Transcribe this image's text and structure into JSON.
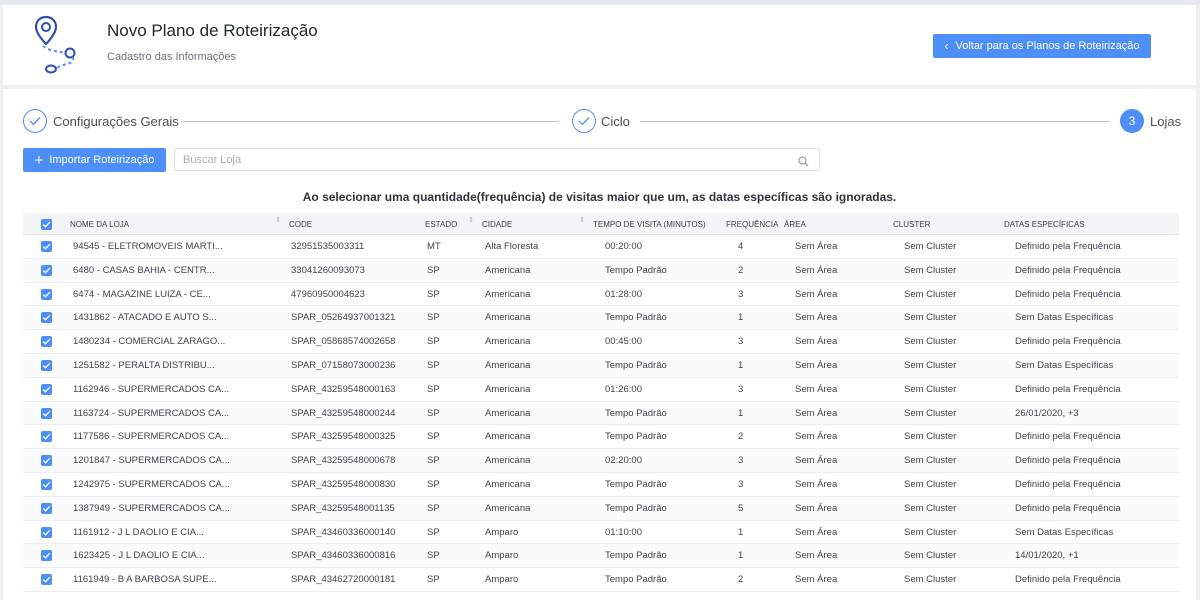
{
  "header": {
    "title": "Novo Plano de Roteirização",
    "subtitle": "Cadastro das Informações",
    "back_button": "Voltar para os Planos de Roteirização"
  },
  "steps": [
    {
      "label": "Configurações Gerais",
      "state": "done"
    },
    {
      "label": "Ciclo",
      "state": "done"
    },
    {
      "label": "Lojas",
      "number": "3",
      "state": "active"
    }
  ],
  "toolbar": {
    "import_label": "Importar Roteirização",
    "search_placeholder": "Buscar Loja"
  },
  "notice": "Ao selecionar uma quantidade(frequência) de visitas maior que um, as datas específicas são ignoradas.",
  "table": {
    "columns": {
      "nome": "NOME DA LOJA",
      "code": "CODE",
      "estado": "ESTADO",
      "cidade": "CIDADE",
      "tempo": "TEMPO DE VISITA (MINUTOS)",
      "frequencia": "FREQUÊNCIA",
      "area": "ÁREA",
      "cluster": "CLUSTER",
      "datas": "DATAS ESPECÍFICAS"
    },
    "rows": [
      {
        "nome": "94545 - ELETROMOVEIS MARTI...",
        "code": "32951535003311",
        "estado": "MT",
        "cidade": "Alta Floresta",
        "tempo": "00:20:00",
        "frequencia": "4",
        "area": "Sem Área",
        "cluster": "Sem Cluster",
        "datas": "Definido pela Frequência"
      },
      {
        "nome": "6480 - CASAS BAHIA - CENTR...",
        "code": "33041260093073",
        "estado": "SP",
        "cidade": "Americana",
        "tempo": "Tempo Padrão",
        "frequencia": "2",
        "area": "Sem Área",
        "cluster": "Sem Cluster",
        "datas": "Definido pela Frequência"
      },
      {
        "nome": "6474 - MAGAZINE LUIZA - CE...",
        "code": "47960950004623",
        "estado": "SP",
        "cidade": "Americana",
        "tempo": "01:28:00",
        "frequencia": "3",
        "area": "Sem Área",
        "cluster": "Sem Cluster",
        "datas": "Definido pela Frequência"
      },
      {
        "nome": "1431862 - ATACADO E AUTO S...",
        "code": "SPAR_05264937001321",
        "estado": "SP",
        "cidade": "Americana",
        "tempo": "Tempo Padrão",
        "frequencia": "1",
        "area": "Sem Área",
        "cluster": "Sem Cluster",
        "datas": "Sem Datas Específicas"
      },
      {
        "nome": "1480234 - COMERCIAL ZARAGO...",
        "code": "SPAR_05868574002658",
        "estado": "SP",
        "cidade": "Americana",
        "tempo": "00:45:00",
        "frequencia": "3",
        "area": "Sem Área",
        "cluster": "Sem Cluster",
        "datas": "Definido pela Frequência"
      },
      {
        "nome": "1251582 - PERALTA DISTRIBU...",
        "code": "SPAR_07158073000236",
        "estado": "SP",
        "cidade": "Americana",
        "tempo": "Tempo Padrão",
        "frequencia": "1",
        "area": "Sem Área",
        "cluster": "Sem Cluster",
        "datas": "Sem Datas Específicas"
      },
      {
        "nome": "1162946 - SUPERMERCADOS CA...",
        "code": "SPAR_43259548000163",
        "estado": "SP",
        "cidade": "Americana",
        "tempo": "01:26:00",
        "frequencia": "3",
        "area": "Sem Área",
        "cluster": "Sem Cluster",
        "datas": "Definido pela Frequência"
      },
      {
        "nome": "1163724 - SUPERMERCADOS CA...",
        "code": "SPAR_43259548000244",
        "estado": "SP",
        "cidade": "Americana",
        "tempo": "Tempo Padrão",
        "frequencia": "1",
        "area": "Sem Área",
        "cluster": "Sem Cluster",
        "datas": "26/01/2020, +3"
      },
      {
        "nome": "1177586 - SUPERMERCADOS CA...",
        "code": "SPAR_43259548000325",
        "estado": "SP",
        "cidade": "Americana",
        "tempo": "Tempo Padrão",
        "frequencia": "2",
        "area": "Sem Área",
        "cluster": "Sem Cluster",
        "datas": "Definido pela Frequência"
      },
      {
        "nome": "1201847 - SUPERMERCADOS CA...",
        "code": "SPAR_43259548000678",
        "estado": "SP",
        "cidade": "Americana",
        "tempo": "02:20:00",
        "frequencia": "3",
        "area": "Sem Área",
        "cluster": "Sem Cluster",
        "datas": "Definido pela Frequência"
      },
      {
        "nome": "1242975 - SUPERMERCADOS CA...",
        "code": "SPAR_43259548000830",
        "estado": "SP",
        "cidade": "Americana",
        "tempo": "Tempo Padrão",
        "frequencia": "3",
        "area": "Sem Área",
        "cluster": "Sem Cluster",
        "datas": "Definido pela Frequência"
      },
      {
        "nome": "1387949 - SUPERMERCADOS CA...",
        "code": "SPAR_43259548001135",
        "estado": "SP",
        "cidade": "Americana",
        "tempo": "Tempo Padrão",
        "frequencia": "5",
        "area": "Sem Área",
        "cluster": "Sem Cluster",
        "datas": "Definido pela Frequência"
      },
      {
        "nome": "1161912 - J L DAOLIO E CIA...",
        "code": "SPAR_43460336000140",
        "estado": "SP",
        "cidade": "Amparo",
        "tempo": "01:10:00",
        "frequencia": "1",
        "area": "Sem Área",
        "cluster": "Sem Cluster",
        "datas": "Sem Datas Específicas"
      },
      {
        "nome": "1623425 - J L DAOLIO E CIA...",
        "code": "SPAR_43460336000816",
        "estado": "SP",
        "cidade": "Amparo",
        "tempo": "Tempo Padrão",
        "frequencia": "1",
        "area": "Sem Área",
        "cluster": "Sem Cluster",
        "datas": "14/01/2020, +1"
      },
      {
        "nome": "1161949 - B A BARBOSA SUPE...",
        "code": "SPAR_43462720000181",
        "estado": "SP",
        "cidade": "Amparo",
        "tempo": "Tempo Padrão",
        "frequencia": "2",
        "area": "Sem Área",
        "cluster": "Sem Cluster",
        "datas": "Definido pela Frequência"
      }
    ]
  },
  "colors": {
    "accent": "#4d8ef7"
  },
  "icons": [
    "route-map-logo-icon",
    "chevron-left-icon",
    "check-icon",
    "plus-icon",
    "search-icon",
    "sort-icon",
    "checkbox-checked-icon"
  ]
}
